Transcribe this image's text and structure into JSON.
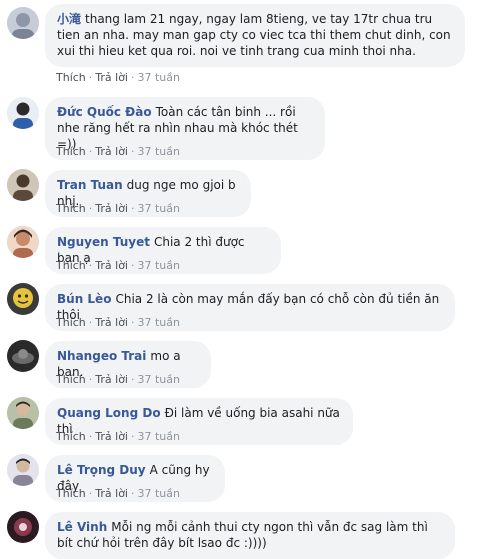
{
  "comments": [
    {
      "author": "小滝",
      "text": "thang lam 21 ngay, ngay lam 8tieng, ve tay 17tr chua tru tien an nha. may man gap cty co viec tca thi them chut dinh, con xui thi hieu ket qua roi. noi ve tinh trang cua minh thoi nha.",
      "like": "Thích",
      "reply": "Trả lời",
      "time": "37 tuần"
    },
    {
      "author": "Đức Quốc Đào",
      "text": "Toàn các tân binh ... rồi nhe răng hết ra nhìn nhau mà khóc thét =))",
      "like": "Thích",
      "reply": "Trả lời",
      "time": "37 tuần"
    },
    {
      "author": "Tran Tuan",
      "text": "dug nge mo gjoi b nhj.",
      "like": "Thích",
      "reply": "Trả lời",
      "time": "37 tuần"
    },
    {
      "author": "Nguyen Tuyet",
      "text": "Chia 2 thì được bạn ạ",
      "like": "Thích",
      "reply": "Trả lời",
      "time": "37 tuần"
    },
    {
      "author": "Bún Lèo",
      "text": "Chia 2 là còn may mắn đấy bạn có chỗ còn đủ tiền ăn thôi",
      "like": "Thích",
      "reply": "Trả lời",
      "time": "37 tuần"
    },
    {
      "author": "Nhangeo Trai",
      "text": "mo a ban.",
      "like": "Thích",
      "reply": "Trả lời",
      "time": "37 tuần"
    },
    {
      "author": "Quang Long Do",
      "text": "Đi làm về uống bia asahi nữa thì",
      "like": "Thích",
      "reply": "Trả lời",
      "time": "37 tuần"
    },
    {
      "author": "Lê Trọng Duy",
      "text": "A cũng hy đây",
      "like": "Thích",
      "reply": "Trả lời",
      "time": "37 tuần"
    },
    {
      "author": "Lê Vinh",
      "text": "Mỗi ng mỗi cảnh thui cty ngon thì vẫn đc sag làm thì bít chứ hỏi trên đây bít lsao đc :))))"
    }
  ],
  "avatar_colors": [
    "#9aa7b8",
    "#3c5a8a",
    "#6b5a4a",
    "#c98a6a",
    "#d9c040",
    "#3a3a3a",
    "#7a8a6a",
    "#a09aa8",
    "#5a2a3a"
  ]
}
